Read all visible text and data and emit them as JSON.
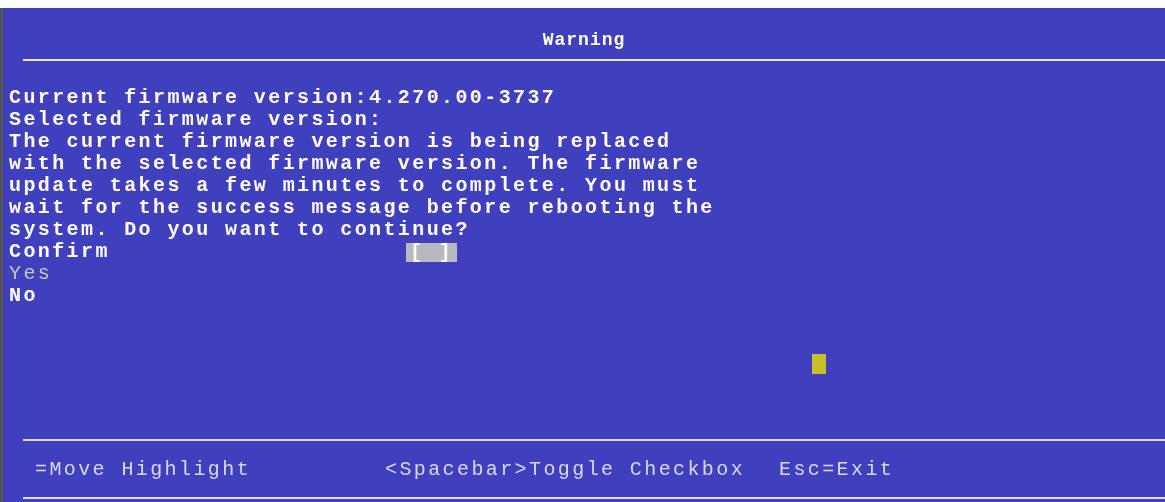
{
  "title": "Warning",
  "lines": [
    "Current firmware version:4.270.00-3737",
    "Selected firmware version:",
    "The current firmware version is being replaced",
    "with the selected firmware version. The firmware",
    "update takes a few minutes to complete. You must",
    "wait for the success message before rebooting the",
    "system. Do you want to continue?"
  ],
  "confirm": {
    "label": "Confirm",
    "box": "[ ]",
    "checked": false
  },
  "options": [
    {
      "label": "Yes",
      "selected": true
    },
    {
      "label": "No",
      "selected": false
    }
  ],
  "footer": [
    "=Move Highlight",
    "<Spacebar>Toggle Checkbox",
    "Esc=Exit"
  ]
}
